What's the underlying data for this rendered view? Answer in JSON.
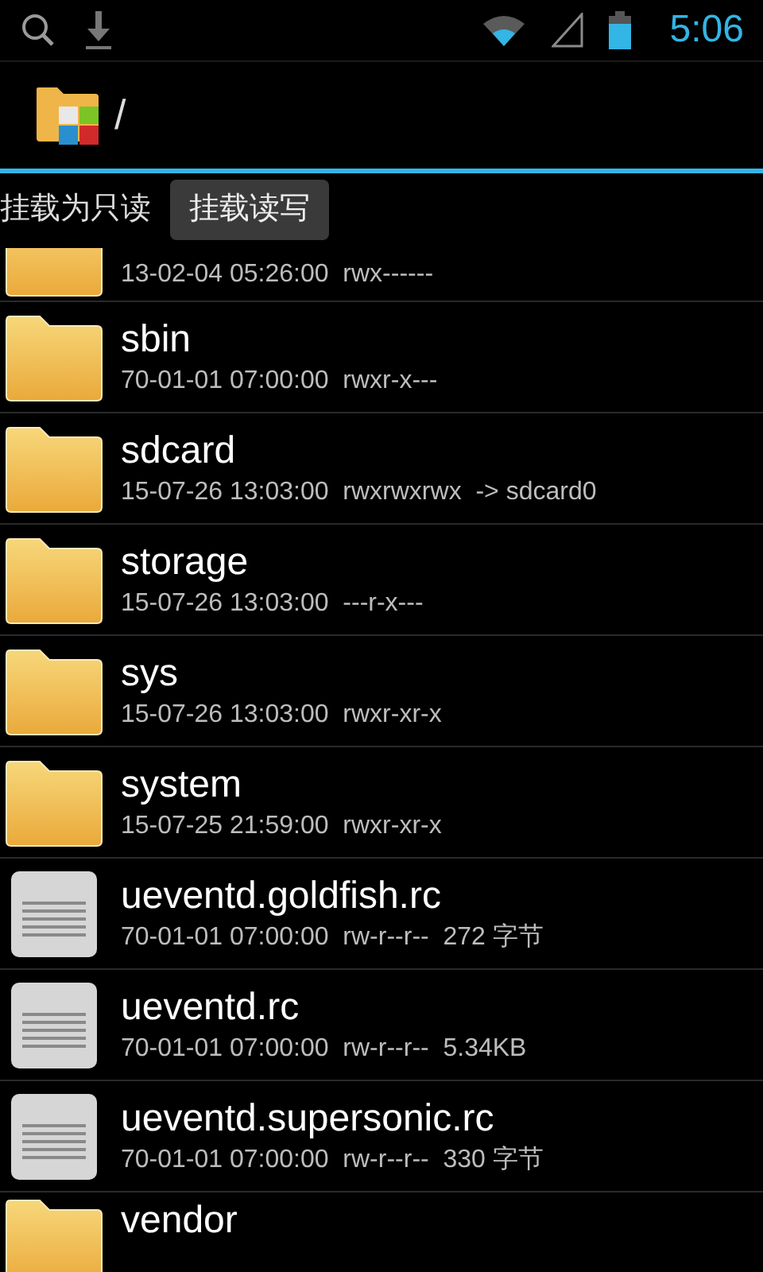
{
  "status_bar": {
    "time": "5:06"
  },
  "header": {
    "path": "/"
  },
  "mount_bar": {
    "label": "挂载为只读",
    "button": "挂载读写"
  },
  "files": [
    {
      "kind": "folder",
      "cut_top": true,
      "details": "13-02-04 05:26:00  rwx------"
    },
    {
      "kind": "folder",
      "name": "sbin",
      "details": "70-01-01 07:00:00  rwxr-x---"
    },
    {
      "kind": "folder",
      "name": "sdcard",
      "details": "15-07-26 13:03:00  rwxrwxrwx  -> sdcard0"
    },
    {
      "kind": "folder",
      "name": "storage",
      "details": "15-07-26 13:03:00  ---r-x---"
    },
    {
      "kind": "folder",
      "name": "sys",
      "details": "15-07-26 13:03:00  rwxr-xr-x"
    },
    {
      "kind": "folder",
      "name": "system",
      "details": "15-07-25 21:59:00  rwxr-xr-x"
    },
    {
      "kind": "file",
      "name": "ueventd.goldfish.rc",
      "details": "70-01-01 07:00:00  rw-r--r--  272 字节"
    },
    {
      "kind": "file",
      "name": "ueventd.rc",
      "details": "70-01-01 07:00:00  rw-r--r--  5.34KB"
    },
    {
      "kind": "file",
      "name": "ueventd.supersonic.rc",
      "details": "70-01-01 07:00:00  rw-r--r--  330 字节"
    },
    {
      "kind": "folder",
      "cut_bottom": true,
      "name": "vendor"
    }
  ]
}
